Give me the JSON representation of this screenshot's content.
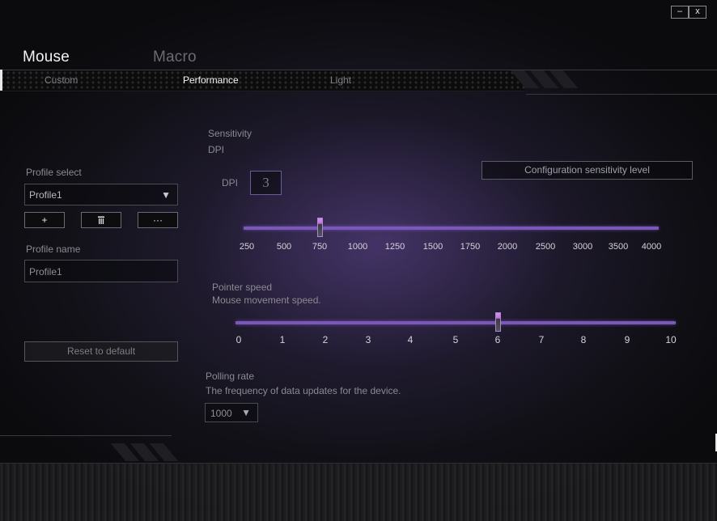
{
  "window": {
    "minimize_label": "–",
    "close_label": "x"
  },
  "top_tabs": {
    "mouse": "Mouse",
    "macro": "Macro"
  },
  "sub_tabs": {
    "custom": "Custom",
    "performance": "Performance",
    "light": "Light"
  },
  "sidebar": {
    "profile_select_label": "Profile select",
    "profile_select_value": "Profile1",
    "dropdown_arrow": "▼",
    "add_label": "+",
    "delete_icon": "trash-icon",
    "more_label": "···",
    "profile_name_label": "Profile name",
    "profile_name_value": "Profile1",
    "reset_label": "Reset to default"
  },
  "sensitivity": {
    "title": "Sensitivity",
    "subtitle": "DPI",
    "config_button": "Configuration sensitivity level",
    "dpi_label": "DPI",
    "dpi_level": "3",
    "ticks": [
      "250",
      "500",
      "750",
      "1000",
      "1250",
      "1500",
      "1750",
      "2000",
      "2500",
      "3000",
      "3500",
      "4000"
    ],
    "selected_value": "750"
  },
  "pointer": {
    "title": "Pointer speed",
    "description": "Mouse movement speed.",
    "ticks": [
      "0",
      "1",
      "2",
      "3",
      "4",
      "5",
      "6",
      "7",
      "8",
      "9",
      "10"
    ],
    "selected_value": 6
  },
  "polling": {
    "title": "Polling rate",
    "description": "The frequency of data updates for the device.",
    "value": "1000",
    "arrow": "▼"
  },
  "colors": {
    "accent": "#7a58b8",
    "thumb": "#d98cf0"
  }
}
